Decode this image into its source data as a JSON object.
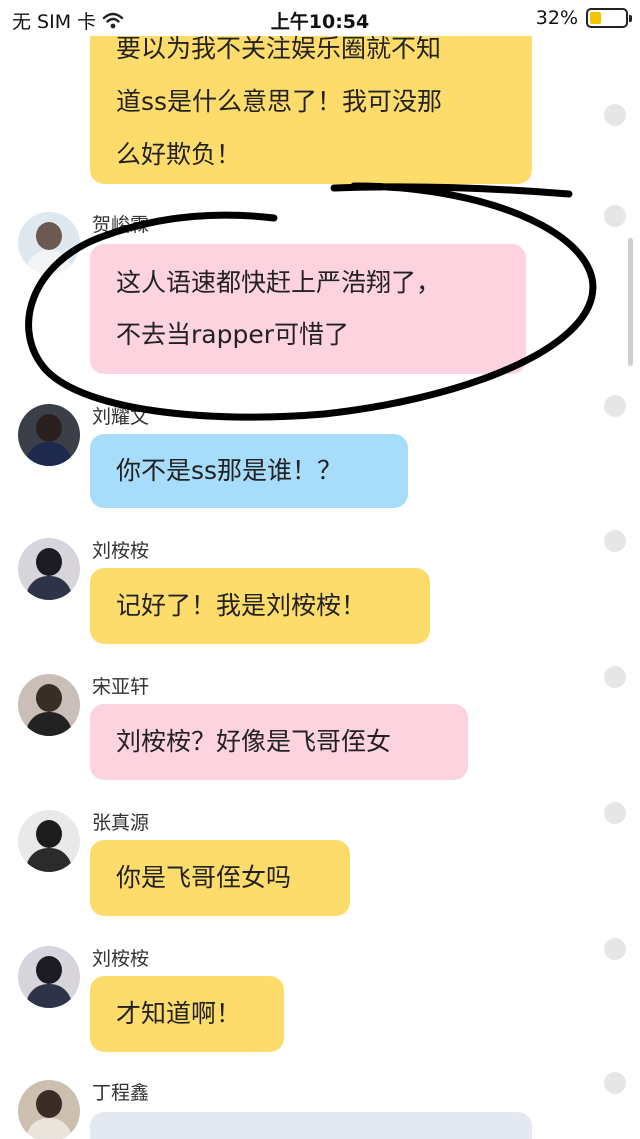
{
  "status_bar": {
    "carrier": "无 SIM 卡",
    "time": "上午10:54",
    "battery_percent": "32%",
    "battery_level": 0.32
  },
  "messages": [
    {
      "sender": "",
      "lines": [
        "要以为我不关注娱乐圈就不知",
        "道ss是什么意思了！我可没那",
        "么好欺负！"
      ],
      "color": "yellow"
    },
    {
      "sender": "贺峻霖",
      "lines": [
        "这人语速都快赶上严浩翔了，",
        "不去当rapper可惜了"
      ],
      "color": "pink"
    },
    {
      "sender": "刘耀文",
      "lines": [
        "你不是ss那是谁！？"
      ],
      "color": "blue"
    },
    {
      "sender": "刘桉桉",
      "lines": [
        "记好了！我是刘桉桉！"
      ],
      "color": "yellow"
    },
    {
      "sender": "宋亚轩",
      "lines": [
        "刘桉桉？好像是飞哥侄女"
      ],
      "color": "pink"
    },
    {
      "sender": "张真源",
      "lines": [
        "你是飞哥侄女吗"
      ],
      "color": "yellow"
    },
    {
      "sender": "刘桉桉",
      "lines": [
        "才知道啊！"
      ],
      "color": "yellow"
    },
    {
      "sender": "丁程鑫",
      "lines": [
        ""
      ],
      "color": "gray"
    }
  ],
  "colors": {
    "yellow_bubble": "#fddc6c",
    "pink_bubble": "#fdd3df",
    "blue_bubble": "#a7dcfb",
    "gray_bubble": "#e4e9f1",
    "annotation_ink": "#000000"
  },
  "icons": [
    "wifi-icon",
    "battery-icon",
    "avatar-icon",
    "select-radio-icon"
  ]
}
